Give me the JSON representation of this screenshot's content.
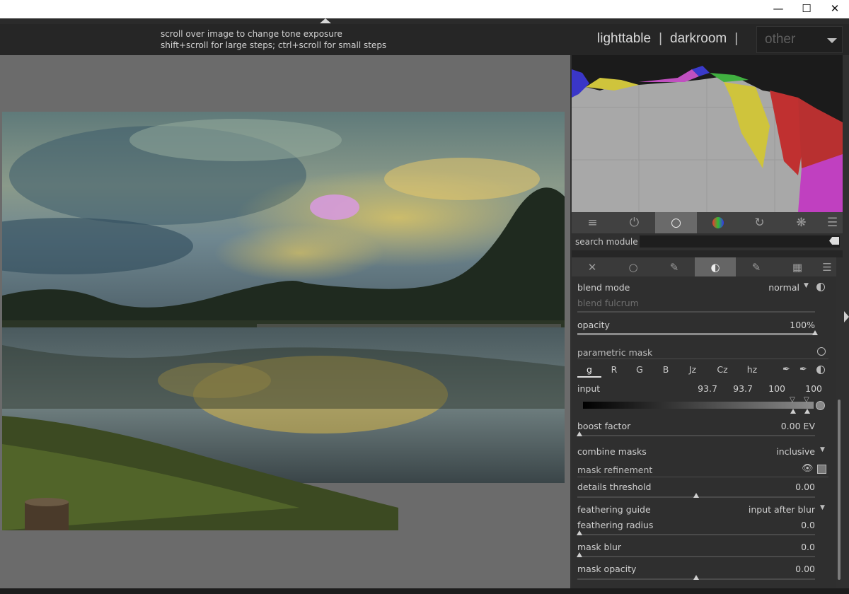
{
  "window": {
    "minimize_icon": "minimize-icon",
    "maximize_icon": "maximize-icon",
    "close_icon": "close-icon"
  },
  "header": {
    "hint_line1": "scroll over image to change tone exposure",
    "hint_line2": "shift+scroll for large steps; ctrl+scroll for small steps",
    "views": {
      "lighttable": "lighttable",
      "separator": "|",
      "darkroom": "darkroom",
      "other": "other"
    }
  },
  "colors": {
    "accent_active": "#6a6a6a",
    "panel_bg": "#303030",
    "center_bg": "#6b6b6b"
  },
  "module_groups": [
    "sliders-icon",
    "power-icon",
    "circle-icon",
    "color-wheel-icon",
    "rotate-icon",
    "aperture-icon",
    "menu-icon"
  ],
  "search": {
    "label": "search module",
    "placeholder": ""
  },
  "blend_tabs": [
    "off-icon",
    "uniform-icon",
    "drawn-icon",
    "parametric-icon",
    "drawn-parametric-icon",
    "raster-icon",
    "menu-icon"
  ],
  "blend": {
    "blend_mode_label": "blend mode",
    "blend_mode_value": "normal",
    "blend_fulcrum_label": "blend fulcrum",
    "opacity_label": "opacity",
    "opacity_value": "100%",
    "opacity_level": 1.0,
    "parametric_mask_label": "parametric mask",
    "channels": [
      "g",
      "R",
      "G",
      "B",
      "Jz",
      "Cz",
      "hz"
    ],
    "input_label": "input",
    "input_values": [
      "93.7",
      "93.7",
      "100",
      "100"
    ],
    "boost_factor_label": "boost factor",
    "boost_factor_value": "0.00 EV",
    "combine_masks_label": "combine masks",
    "combine_masks_value": "inclusive",
    "mask_refinement_label": "mask refinement",
    "details_threshold_label": "details threshold",
    "details_threshold_value": "0.00",
    "feathering_guide_label": "feathering guide",
    "feathering_guide_value": "input after blur",
    "feathering_radius_label": "feathering radius",
    "feathering_radius_value": "0.0",
    "mask_blur_label": "mask blur",
    "mask_blur_value": "0.0",
    "mask_opacity_label": "mask opacity",
    "mask_opacity_value": "0.00"
  }
}
